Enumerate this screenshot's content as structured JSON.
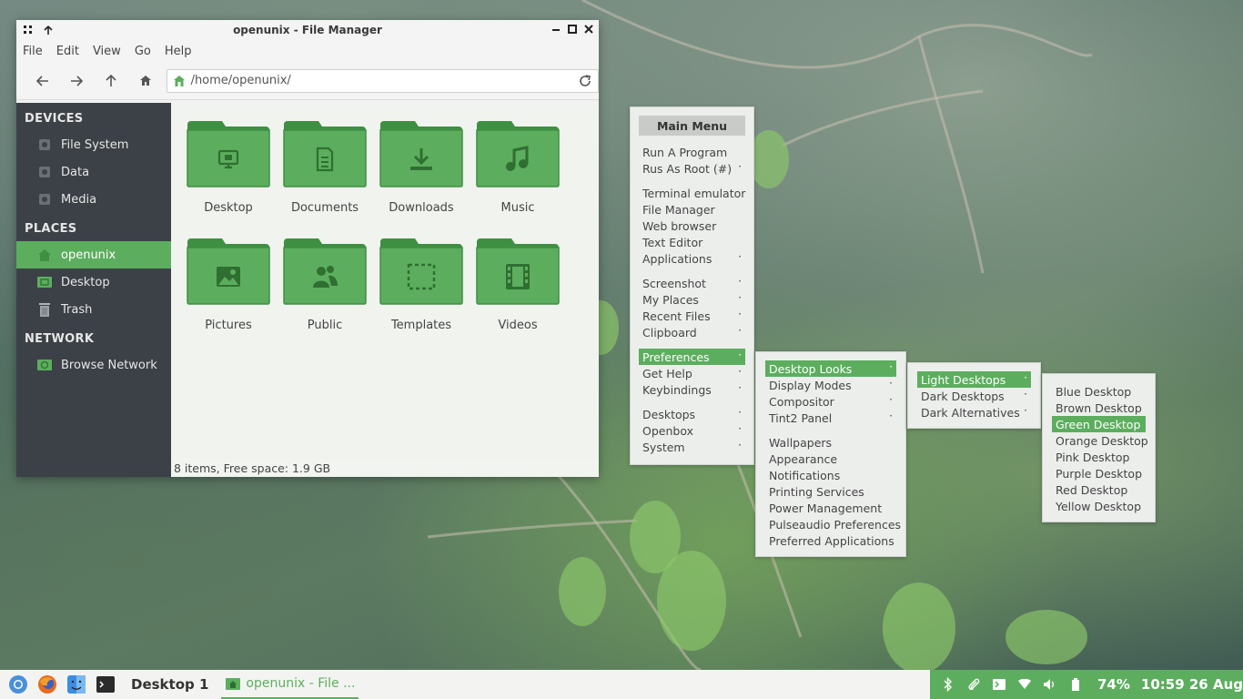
{
  "window": {
    "title": "openunix - File Manager",
    "menu": [
      "File",
      "Edit",
      "View",
      "Go",
      "Help"
    ],
    "location": "/home/openunix/",
    "status": "8 items, Free space: 1.9 GB"
  },
  "sidebar": {
    "devices_heading": "DEVICES",
    "devices": [
      "File System",
      "Data",
      "Media"
    ],
    "places_heading": "PLACES",
    "places": [
      "openunix",
      "Desktop",
      "Trash"
    ],
    "network_heading": "NETWORK",
    "network": [
      "Browse Network"
    ]
  },
  "folders": [
    {
      "label": "Desktop",
      "icon": "monitor-icon"
    },
    {
      "label": "Documents",
      "icon": "document-icon"
    },
    {
      "label": "Downloads",
      "icon": "download-icon"
    },
    {
      "label": "Music",
      "icon": "music-note-icon"
    },
    {
      "label": "Pictures",
      "icon": "image-icon"
    },
    {
      "label": "Public",
      "icon": "people-icon"
    },
    {
      "label": "Templates",
      "icon": "dashed-box-icon"
    },
    {
      "label": "Videos",
      "icon": "film-icon"
    }
  ],
  "main_menu": {
    "title": "Main Menu",
    "groups": [
      [
        "Run A Program",
        "Rus As Root (#)"
      ],
      [
        "Terminal emulator",
        "File Manager",
        "Web browser",
        "Text Editor",
        "Applications"
      ],
      [
        "Screenshot",
        "My Places",
        "Recent Files",
        "Clipboard"
      ],
      [
        "Preferences",
        "Get Help",
        "Keybindings"
      ],
      [
        "Desktops",
        "Openbox",
        "System"
      ]
    ]
  },
  "prefs_menu": {
    "groups": [
      [
        "Desktop Looks",
        "Display Modes",
        "Compositor",
        "Tint2 Panel"
      ],
      [
        "Wallpapers",
        "Appearance",
        "Notifications",
        "Printing Services",
        "Power Management",
        "Pulseaudio Preferences",
        "Preferred Applications"
      ]
    ]
  },
  "looks_menu": [
    "Light Desktops",
    "Dark Desktops",
    "Dark Alternatives"
  ],
  "light_menu": [
    "Blue Desktop",
    "Brown Desktop",
    "Green Desktop",
    "Orange Desktop",
    "Pink Desktop",
    "Purple Desktop",
    "Red Desktop",
    "Yellow Desktop"
  ],
  "taskbar": {
    "desktop": "Desktop 1",
    "task": "openunix - File ...",
    "battery": "74%",
    "clock": "10:59 26 Aug"
  },
  "colors": {
    "accent": "#5cae5e",
    "sidebar": "#3c4147",
    "folder": "#5cae5e"
  }
}
